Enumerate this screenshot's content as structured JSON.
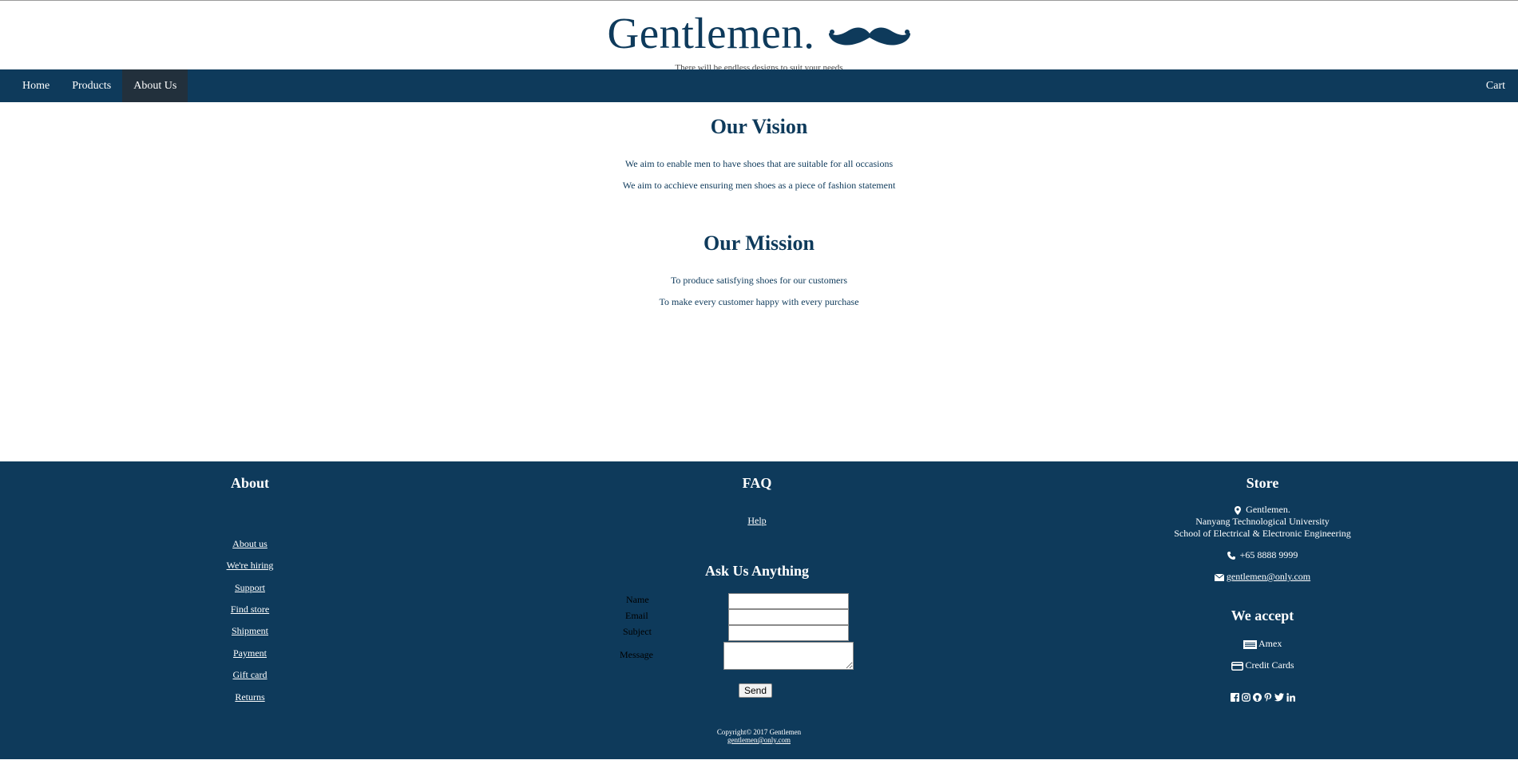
{
  "header": {
    "brand": "Gentlemen.",
    "tagline": "There will be endless designs to suit your needs"
  },
  "nav": {
    "items": [
      {
        "label": "Home"
      },
      {
        "label": "Products"
      },
      {
        "label": "About Us"
      }
    ],
    "cart": "Cart"
  },
  "vision": {
    "title": "Our Vision",
    "lines": [
      "We aim to enable men to have shoes that are suitable for all occasions",
      "We aim to acchieve ensuring men shoes as a piece of fashion statement"
    ]
  },
  "mission": {
    "title": "Our Mission",
    "lines": [
      "To produce satisfying shoes for our customers",
      "To make every customer happy with every purchase"
    ]
  },
  "footer": {
    "about": {
      "title": "About",
      "links": [
        "About us",
        "We're hiring",
        "Support",
        "Find store",
        "Shipment",
        "Payment",
        "Gift card",
        "Returns"
      ]
    },
    "faq": {
      "title": "FAQ",
      "help": "Help"
    },
    "ask": {
      "title": "Ask Us Anything",
      "name_label": "Name",
      "email_label": "Email",
      "subject_label": "Subject",
      "message_label": "Message",
      "send": "Send"
    },
    "store": {
      "title": "Store",
      "name": "Gentlemen.",
      "university": "Nanyang Technological University",
      "school": "School of Electrical & Electronic Engineering",
      "phone": "+65 8888 9999",
      "email": "gentlemen@only.com "
    },
    "accept": {
      "title": "We accept",
      "amex": "Amex",
      "credit": "Credit Cards"
    },
    "social_icons": [
      "facebook-icon",
      "instagram-icon",
      "github-icon",
      "pinterest-icon",
      "twitter-icon",
      "linkedin-icon"
    ],
    "copyright": "Copyright© 2017 Gentlemen",
    "copyright_email": "gentlemen@only.com"
  },
  "colors": {
    "brand_navy": "#0e3a5b",
    "active_nav": "#22303c"
  }
}
